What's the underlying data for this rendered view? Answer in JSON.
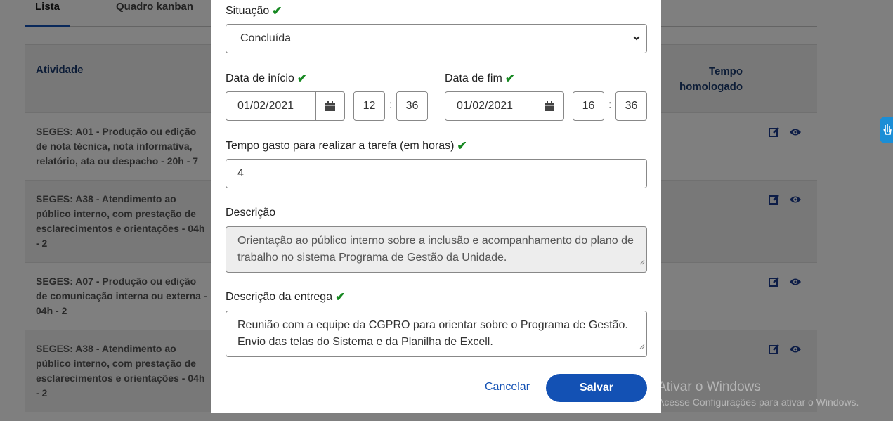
{
  "tabs": {
    "list": "Lista",
    "kanban": "Quadro kanban"
  },
  "table": {
    "col_activity": "Atividade",
    "col_time_line1": "Tempo",
    "col_time_line2": "homologado",
    "rows": [
      {
        "text": "SEGES: A01 - Produção ou edição de nota técnica, nota informativa, relatório, ata ou despacho - 20h - 7"
      },
      {
        "text": "SEGES: A38 - Atendimento ao público interno, com prestação de esclarecimentos e orientações - 04h - 2"
      },
      {
        "text": "SEGES: A07 - Produção ou edição de comunicação interna ou externa - 04h - 2"
      },
      {
        "text": "SEGES: A38 - Atendimento ao público interno, com prestação de esclarecimentos e orientações - 04h - 2"
      }
    ]
  },
  "modal": {
    "status_label": "Situação",
    "status_value": "Concluída",
    "start_label": "Data de início",
    "start_date": "01/02/2021",
    "start_hour": "12",
    "start_minute": "36",
    "end_label": "Data de fim",
    "end_date": "01/02/2021",
    "end_hour": "16",
    "end_minute": "36",
    "time_sep": ":",
    "hours_label": "Tempo gasto para realizar a tarefa (em horas)",
    "hours_value": "4",
    "description_label": "Descrição",
    "description_value": "Orientação ao público interno sobre a inclusão e acompanhamento do plano de trabalho no sistema Programa de Gestão da Unidade.",
    "delivery_label": "Descrição da entrega",
    "delivery_value": "Reunião com a equipe da CGPRO para orientar sobre o Programa de Gestão. Envio das telas do Sistema e da Planilha de Excell.",
    "cancel_label": "Cancelar",
    "save_label": "Salvar"
  },
  "watermark": {
    "title": "Ativar o Windows",
    "subtitle": "Acesse Configurações para ativar o Windows."
  },
  "colors": {
    "primary": "#1351b4",
    "success": "#168821",
    "header_text": "#1a3a6e"
  }
}
